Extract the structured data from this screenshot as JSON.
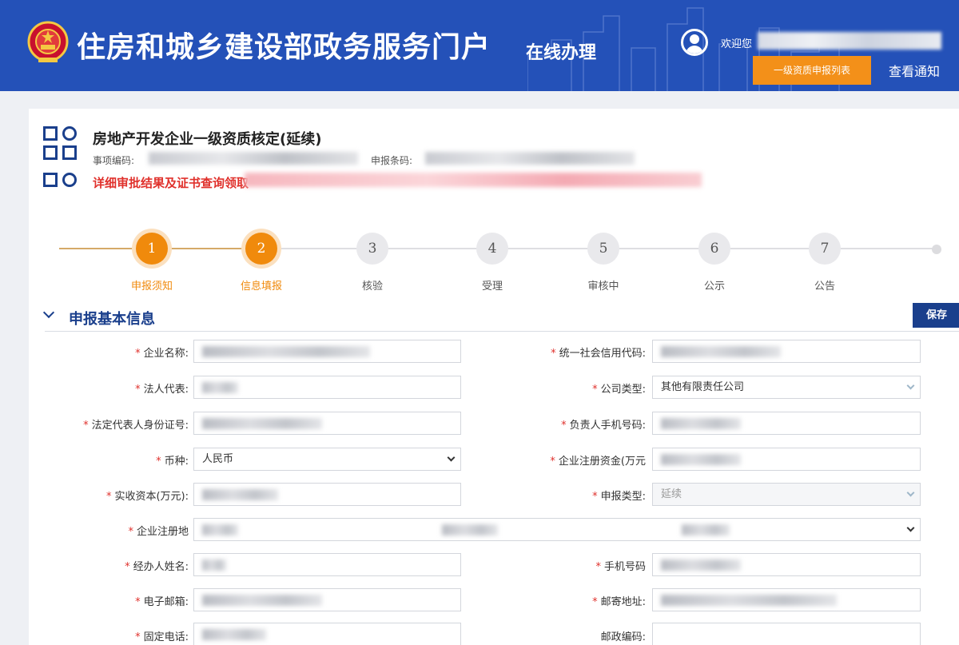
{
  "header": {
    "portal_title": "住房和城乡建设部政务服务门户",
    "online_label": "在线办理",
    "welcome_prefix": "欢迎您",
    "list_button": "一级资质申报列表",
    "notice_link": "查看通知",
    "icons": {
      "emblem": "national-emblem-icon",
      "avatar": "user-avatar-icon"
    }
  },
  "item": {
    "title": "房地产开发企业一级资质核定(延续)",
    "code_label": "事项编码:",
    "barcode_label": "申报条码:",
    "result_link": "详细审批结果及证书查询领取"
  },
  "steps": [
    {
      "number": "1",
      "label": "申报须知",
      "status": "done"
    },
    {
      "number": "2",
      "label": "信息填报",
      "status": "done"
    },
    {
      "number": "3",
      "label": "核验",
      "status": "todo"
    },
    {
      "number": "4",
      "label": "受理",
      "status": "todo"
    },
    {
      "number": "5",
      "label": "审核中",
      "status": "todo"
    },
    {
      "number": "6",
      "label": "公示",
      "status": "todo"
    },
    {
      "number": "7",
      "label": "公告",
      "status": "todo"
    }
  ],
  "section": {
    "title": "申报基本信息",
    "save_button": "保存"
  },
  "form": {
    "company_name": {
      "label": "企业名称:",
      "required": true,
      "value": ""
    },
    "credit_code": {
      "label": "统一社会信用代码:",
      "required": true,
      "value": ""
    },
    "legal_rep": {
      "label": "法人代表:",
      "required": true,
      "value": ""
    },
    "company_type": {
      "label": "公司类型:",
      "required": true,
      "value": "其他有限责任公司"
    },
    "legal_rep_id": {
      "label": "法定代表人身份证号:",
      "required": true,
      "value": ""
    },
    "manager_phone": {
      "label": "负责人手机号码:",
      "required": true,
      "value": ""
    },
    "currency": {
      "label": "币种:",
      "required": true,
      "value": "人民币"
    },
    "registered_capital": {
      "label": "企业注册资金(万元",
      "required": true,
      "value": ""
    },
    "paid_capital": {
      "label": "实收资本(万元):",
      "required": true,
      "value": ""
    },
    "declare_type": {
      "label": "申报类型:",
      "required": true,
      "value": "延续"
    },
    "reg_address": {
      "label": "企业注册地",
      "required": true,
      "value": ""
    },
    "agent_name": {
      "label": "经办人姓名:",
      "required": true,
      "value": ""
    },
    "mobile": {
      "label": "手机号码",
      "required": true,
      "value": ""
    },
    "email": {
      "label": "电子邮箱:",
      "required": true,
      "value": ""
    },
    "mail_address": {
      "label": "邮寄地址:",
      "required": true,
      "value": ""
    },
    "fixed_phone": {
      "label": "固定电话:",
      "required": true,
      "value": ""
    },
    "postal_code": {
      "label": "邮政编码:",
      "required": false,
      "value": ""
    }
  },
  "colors": {
    "header_bg": "#2451b8",
    "accent_orange": "#f08a0c",
    "primary_navy": "#1a3f8c",
    "required_red": "#e0312c"
  }
}
